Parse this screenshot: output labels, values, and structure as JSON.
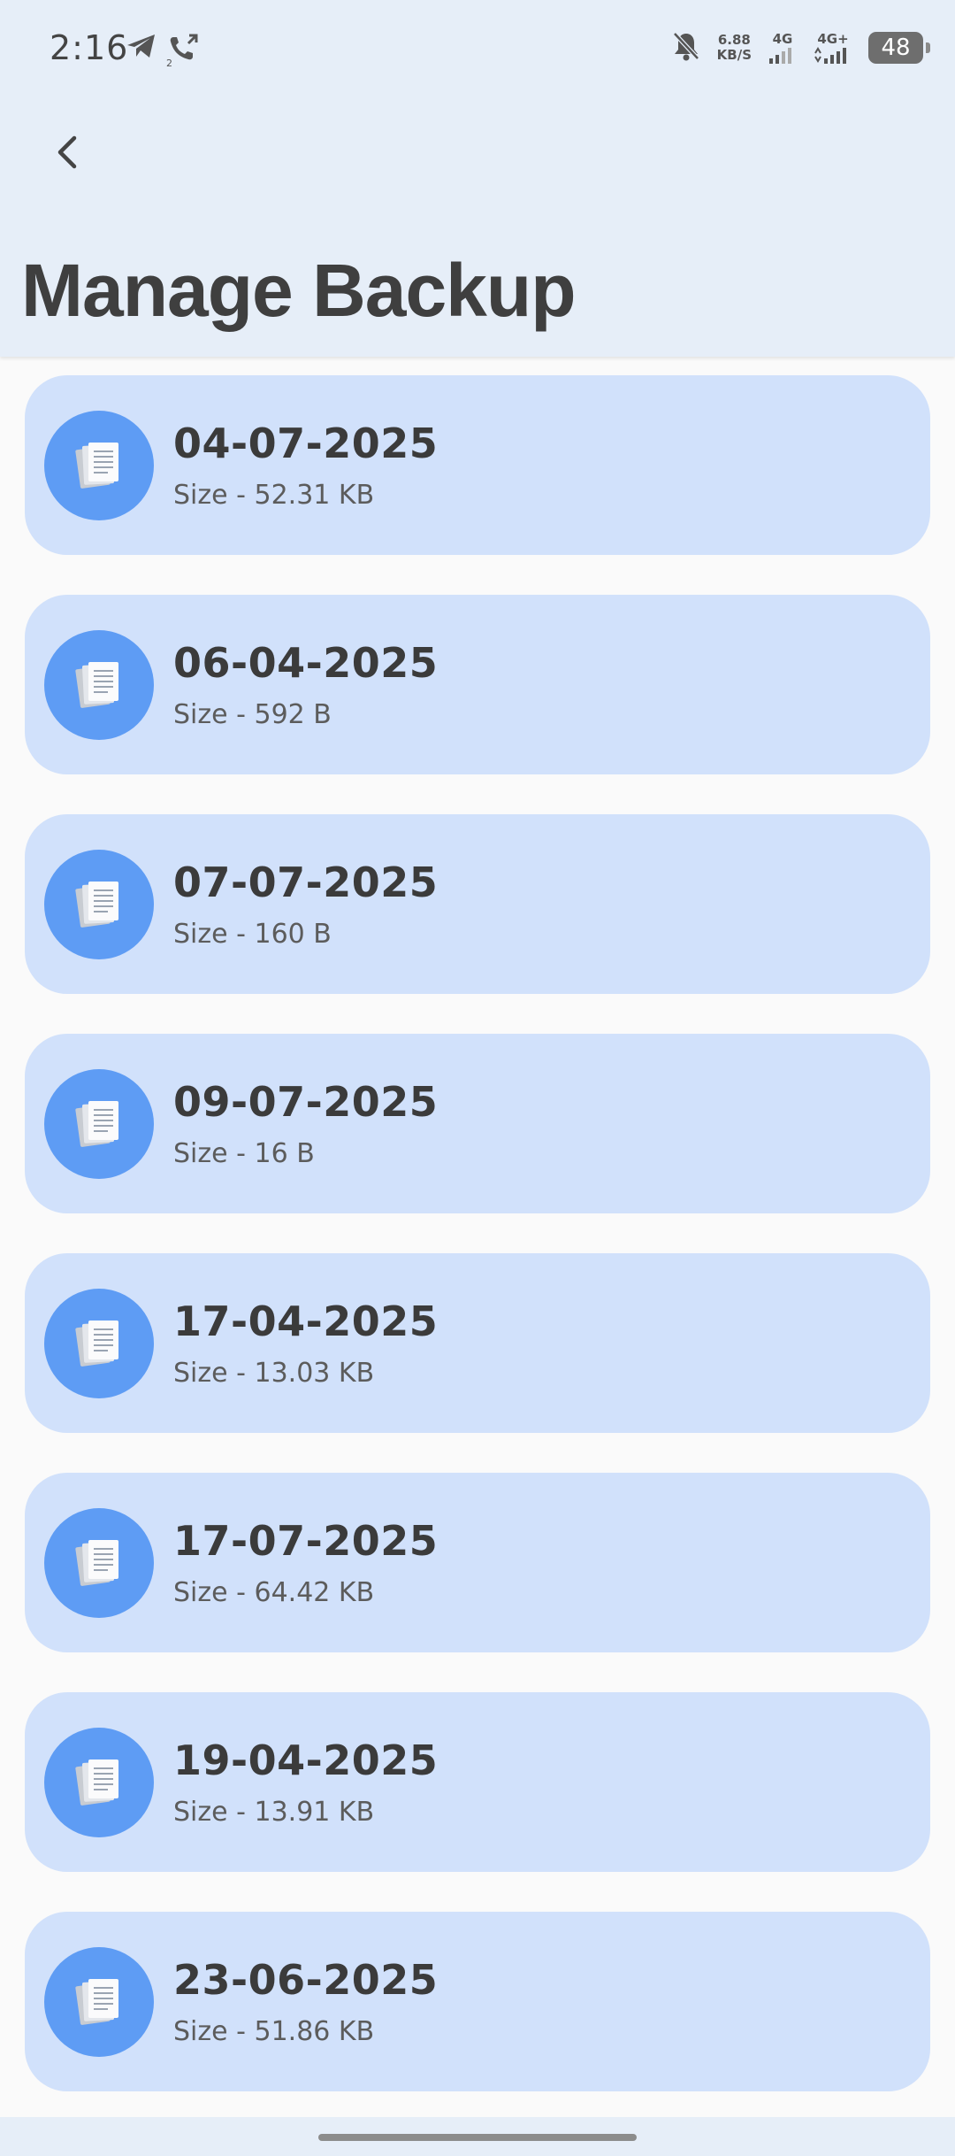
{
  "status_bar": {
    "time": "2:16",
    "net_speed_value": "6.88",
    "net_speed_unit": "KB/S",
    "signal1_label": "4G",
    "signal2_label": "4G+",
    "battery": "48"
  },
  "header": {
    "title": "Manage Backup",
    "back_icon": "chevron-left-icon"
  },
  "backups": [
    {
      "date": "04-07-2025",
      "size": "Size - 52.31 KB"
    },
    {
      "date": "06-04-2025",
      "size": "Size - 592 B"
    },
    {
      "date": "07-07-2025",
      "size": "Size - 160 B"
    },
    {
      "date": "09-07-2025",
      "size": "Size - 16 B"
    },
    {
      "date": "17-04-2025",
      "size": "Size - 13.03 KB"
    },
    {
      "date": "17-07-2025",
      "size": "Size - 64.42 KB"
    },
    {
      "date": "19-04-2025",
      "size": "Size - 13.91 KB"
    },
    {
      "date": "23-06-2025",
      "size": "Size - 51.86 KB"
    }
  ],
  "colors": {
    "header_bg": "#e6eef8",
    "card_bg": "#d1e1fb",
    "icon_circle": "#5e9cf4"
  }
}
